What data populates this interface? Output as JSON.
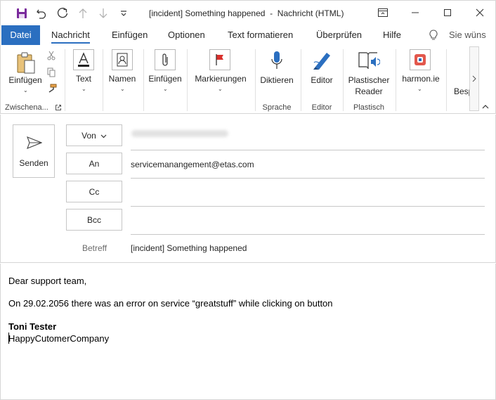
{
  "window": {
    "title": "[incident] Something happened  -  Nachricht (HTML)"
  },
  "tabs": {
    "file": "Datei",
    "message": "Nachricht",
    "insert": "Einfügen",
    "options": "Optionen",
    "format_text": "Text formatieren",
    "review": "Überprüfen",
    "help": "Hilfe",
    "tell_me": "Sie wüns"
  },
  "ribbon": {
    "paste": "Einfügen",
    "clipboard_group": "Zwischena...",
    "text": "Text",
    "names": "Namen",
    "insert": "Einfügen",
    "tags": "Markierungen",
    "dictate": "Diktieren",
    "voice_group": "Sprache",
    "editor": "Editor",
    "editor_group": "Editor",
    "immersive_reader_1": "Plastischer",
    "immersive_reader_2": "Reader",
    "immersive_group": "Plastisch",
    "harmon": "harmon.ie",
    "overflow": "Besp"
  },
  "compose": {
    "send": "Senden",
    "from_label": "Von",
    "to_label": "An",
    "to_value": "servicemanangement@etas.com",
    "cc_label": "Cc",
    "bcc_label": "Bcc",
    "subject_label": "Betreff",
    "subject_value": "[incident] Something happened"
  },
  "body": {
    "greeting": "Dear support team,",
    "line1": "On 29.02.2056 there was an error on service “greatstuff” while clicking on button",
    "signature_name": "Toni Tester",
    "signature_company": "HappyCutomerCompany"
  },
  "colors": {
    "accent": "#2b6fc0",
    "save_icon": "#7a2a9c"
  }
}
